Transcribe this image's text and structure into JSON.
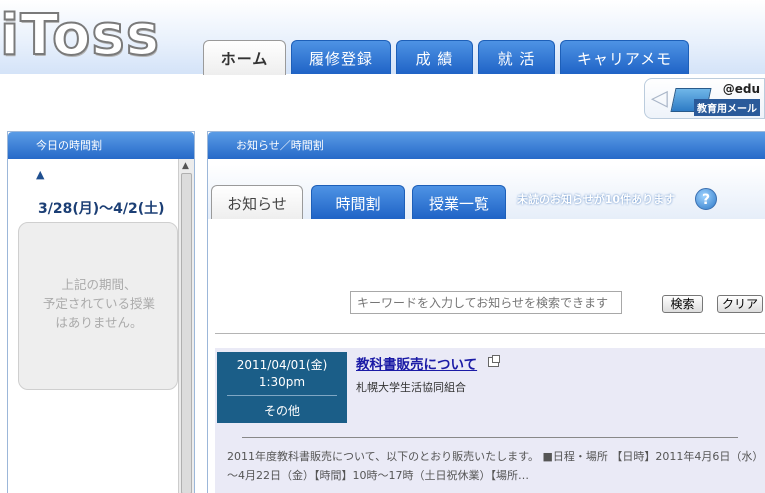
{
  "app": {
    "logo": "iToss"
  },
  "top_nav": {
    "tabs": [
      {
        "label": "ホーム"
      },
      {
        "label": "履修登録"
      },
      {
        "label": "成 績"
      },
      {
        "label": "就 活"
      },
      {
        "label": "キャリアメモ"
      }
    ]
  },
  "edu_mail": {
    "domain": "@edu",
    "label": "教育用メール"
  },
  "left_panel": {
    "title": "今日の時間割",
    "date_range": "3/28(月)～4/2(土)",
    "empty_message": [
      "上記の期間、",
      "予定されている授業",
      "はありません。"
    ]
  },
  "main_panel": {
    "title": "お知らせ／時間割",
    "tabs": [
      {
        "label": "お知らせ"
      },
      {
        "label": "時間割"
      },
      {
        "label": "授業一覧"
      }
    ],
    "unread_notice": "未読のお知らせが10件あります",
    "search": {
      "placeholder": "キーワードを入力してお知らせを検索できます",
      "search_label": "検索",
      "clear_label": "クリア"
    },
    "notice": {
      "date": "2011/04/01(金)",
      "time": "1:30pm",
      "category": "その他",
      "title": "教科書販売について",
      "org": "札幌大学生活協同組合",
      "body": "2011年度教科書販売について、以下のとおり販売いたします。 ■日程・場所 【日時】2011年4月6日（水）～4月22日（金）【時間】10時～17時（土日祝休業）【場所…"
    }
  }
}
